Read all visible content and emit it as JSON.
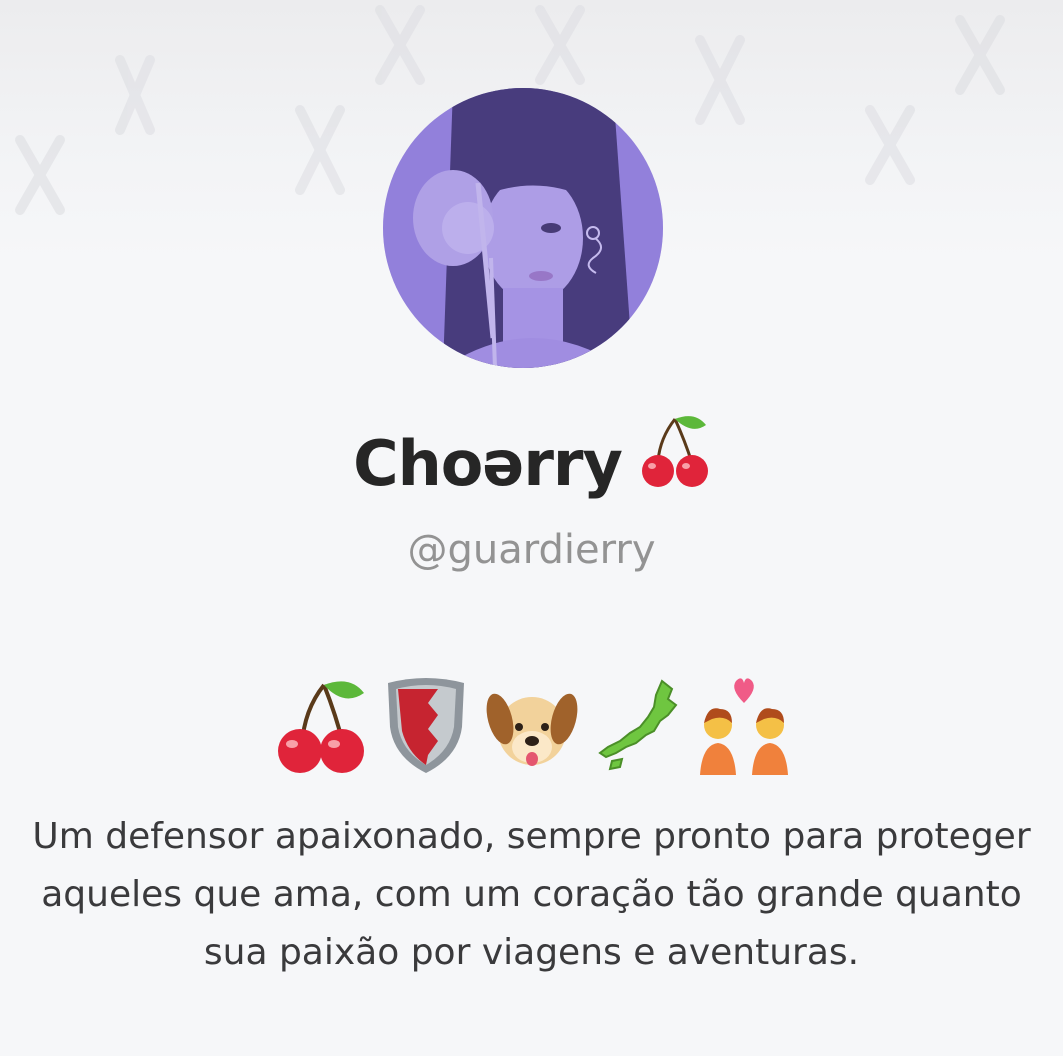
{
  "profile": {
    "display_name": "Choərry",
    "name_emoji_icon": "cherries-icon",
    "username": "@guardierry",
    "avatar_icon": "profile-avatar-photo",
    "avatar_tint": "#8a75d6",
    "emoji_icons": [
      "cherries-icon",
      "shield-icon",
      "dog-face-icon",
      "japan-map-icon",
      "couple-with-heart-icon"
    ],
    "bio": "Um defensor apaixonado, sempre pronto para proteger aqueles que ama, com um coração tão grande quanto sua paixão por viagens e aventuras."
  },
  "colors": {
    "background": "#f6f7f9",
    "name_text": "#262626",
    "username_text": "#939393",
    "bio_text": "#3a3a3c"
  }
}
